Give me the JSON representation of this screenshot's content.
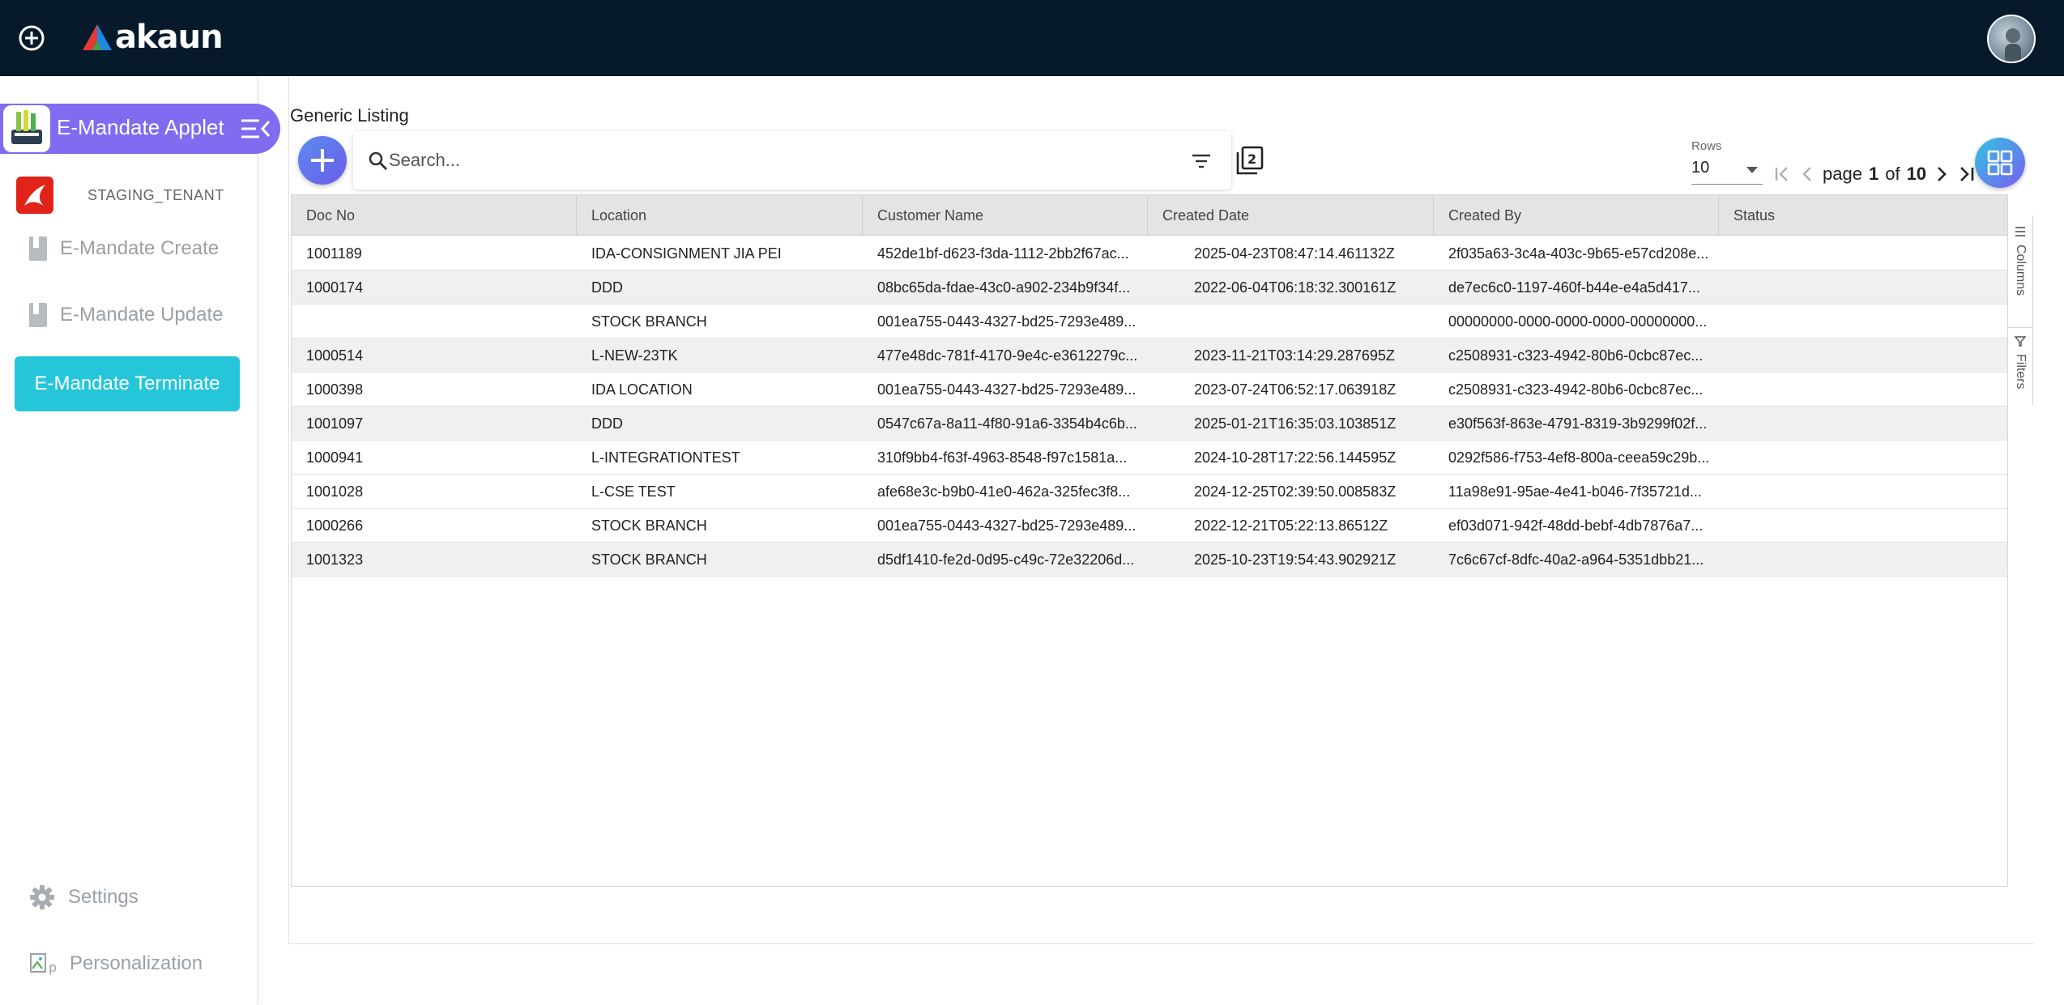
{
  "app": {
    "brand": "akaun",
    "applet_title": "E-Mandate Applet",
    "tenant": "STAGING_TENANT",
    "accent_color": "#7f6cf0",
    "active_color": "#26c6da",
    "topbar_color": "#071a2c"
  },
  "sidebar": {
    "items": [
      {
        "label": "E-Mandate Create"
      },
      {
        "label": "E-Mandate Update"
      },
      {
        "label": "E-Mandate Terminate"
      }
    ],
    "settings_label": "Settings",
    "personalization_label": "Personalization"
  },
  "listing": {
    "title": "Generic Listing",
    "search_placeholder": "Search...",
    "rows_label": "Rows",
    "rows_value": "10",
    "page_word": "page",
    "page_current": "1",
    "of_word": "of",
    "page_total": "10"
  },
  "table": {
    "columns": [
      "Doc No",
      "Location",
      "Customer Name",
      "Created Date",
      "Created By",
      "Status"
    ],
    "rows": [
      {
        "doc_no": "1001189",
        "location": "IDA-CONSIGNMENT JIA PEI",
        "customer": "452de1bf-d623-f3da-1112-2bb2f67ac...",
        "created_date": "2025-04-23T08:47:14.461132Z",
        "created_by": "2f035a63-3c4a-403c-9b65-e57cd208e...",
        "status": ""
      },
      {
        "doc_no": "1000174",
        "location": "DDD",
        "customer": "08bc65da-fdae-43c0-a902-234b9f34f...",
        "created_date": "2022-06-04T06:18:32.300161Z",
        "created_by": "de7ec6c0-1197-460f-b44e-e4a5d417...",
        "status": ""
      },
      {
        "doc_no": "",
        "location": "STOCK BRANCH",
        "customer": "001ea755-0443-4327-bd25-7293e489...",
        "created_date": "",
        "created_by": "00000000-0000-0000-0000-00000000...",
        "status": ""
      },
      {
        "doc_no": "1000514",
        "location": "L-NEW-23TK",
        "customer": "477e48dc-781f-4170-9e4c-e3612279c...",
        "created_date": "2023-11-21T03:14:29.287695Z",
        "created_by": "c2508931-c323-4942-80b6-0cbc87ec...",
        "status": ""
      },
      {
        "doc_no": "1000398",
        "location": "IDA LOCATION",
        "customer": "001ea755-0443-4327-bd25-7293e489...",
        "created_date": "2023-07-24T06:52:17.063918Z",
        "created_by": "c2508931-c323-4942-80b6-0cbc87ec...",
        "status": ""
      },
      {
        "doc_no": "1001097",
        "location": "DDD",
        "customer": "0547c67a-8a11-4f80-91a6-3354b4c6b...",
        "created_date": "2025-01-21T16:35:03.103851Z",
        "created_by": "e30f563f-863e-4791-8319-3b9299f02f...",
        "status": ""
      },
      {
        "doc_no": "1000941",
        "location": "L-INTEGRATIONTEST",
        "customer": "310f9bb4-f63f-4963-8548-f97c1581a...",
        "created_date": "2024-10-28T17:22:56.144595Z",
        "created_by": "0292f586-f753-4ef8-800a-ceea59c29b...",
        "status": ""
      },
      {
        "doc_no": "1001028",
        "location": "L-CSE TEST",
        "customer": "afe68e3c-b9b0-41e0-462a-325fec3f8...",
        "created_date": "2024-12-25T02:39:50.008583Z",
        "created_by": "11a98e91-95ae-4e41-b046-7f35721d...",
        "status": ""
      },
      {
        "doc_no": "1000266",
        "location": "STOCK BRANCH",
        "customer": "001ea755-0443-4327-bd25-7293e489...",
        "created_date": " 2022-12-21T05:22:13.86512Z",
        "created_by": "ef03d071-942f-48dd-bebf-4db7876a7...",
        "status": ""
      },
      {
        "doc_no": "1001323",
        "location": "STOCK BRANCH",
        "customer": "d5df1410-fe2d-0d95-c49c-72e32206d...",
        "created_date": "2025-10-23T19:54:43.902921Z",
        "created_by": "7c6c67cf-8dfc-40a2-a964-5351dbb21...",
        "status": ""
      }
    ]
  },
  "side_panel": {
    "columns_label": "Columns",
    "filters_label": "Filters"
  },
  "icons": {
    "topbar_add": "plus-circle-icon",
    "logo": "akaun-logo-icon",
    "avatar": "user-avatar",
    "applet": "applet-icon",
    "menu": "menu-collapse-icon",
    "tenant": "tenant-logo-icon",
    "nav": "document-icon",
    "settings": "gear-icon",
    "personalization": "broken-image-icon",
    "add": "plus-icon",
    "search": "search-icon",
    "filter": "filter-lines-icon",
    "copy": "copy-stack-icon",
    "grid": "grid-view-icon"
  }
}
